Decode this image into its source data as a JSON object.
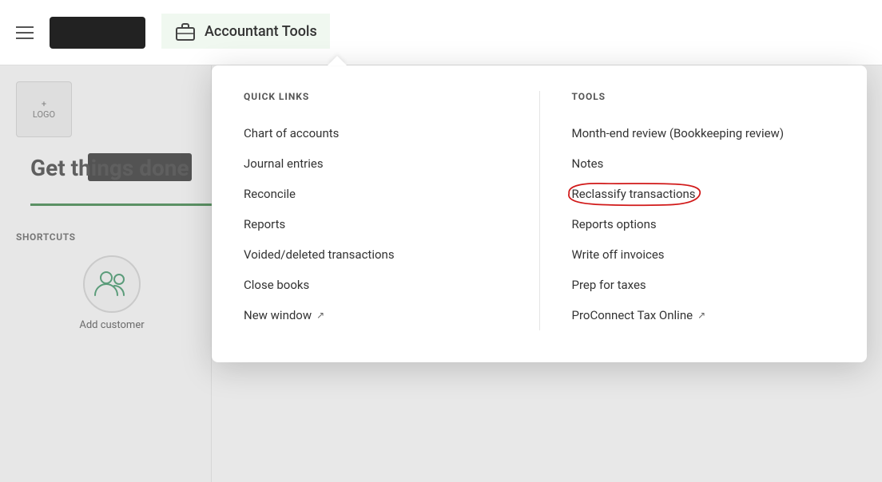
{
  "navbar": {
    "accountant_tools_label": "Accountant Tools",
    "hamburger_label": "Menu"
  },
  "left_panel": {
    "logo_plus": "+",
    "logo_text": "LOGO",
    "get_things_done": "Get things done"
  },
  "shortcuts": {
    "title": "SHORTCUTS",
    "add_customer_label": "Add customer"
  },
  "dropdown": {
    "quick_links_header": "QUICK LINKS",
    "tools_header": "TOOLS",
    "quick_links": [
      {
        "label": "Chart of accounts",
        "external": false
      },
      {
        "label": "Journal entries",
        "external": false
      },
      {
        "label": "Reconcile",
        "external": false
      },
      {
        "label": "Reports",
        "external": false
      },
      {
        "label": "Voided/deleted transactions",
        "external": false
      },
      {
        "label": "Close books",
        "external": false
      },
      {
        "label": "New window",
        "external": true
      }
    ],
    "tools": [
      {
        "label": "Month-end review (Bookkeeping review)",
        "external": false,
        "highlighted": false
      },
      {
        "label": "Notes",
        "external": false,
        "highlighted": false
      },
      {
        "label": "Reclassify transactions",
        "external": false,
        "highlighted": true
      },
      {
        "label": "Reports options",
        "external": false,
        "highlighted": false
      },
      {
        "label": "Write off invoices",
        "external": false,
        "highlighted": false
      },
      {
        "label": "Prep for taxes",
        "external": false,
        "highlighted": false
      },
      {
        "label": "ProConnect Tax Online",
        "external": true,
        "highlighted": false
      }
    ]
  }
}
